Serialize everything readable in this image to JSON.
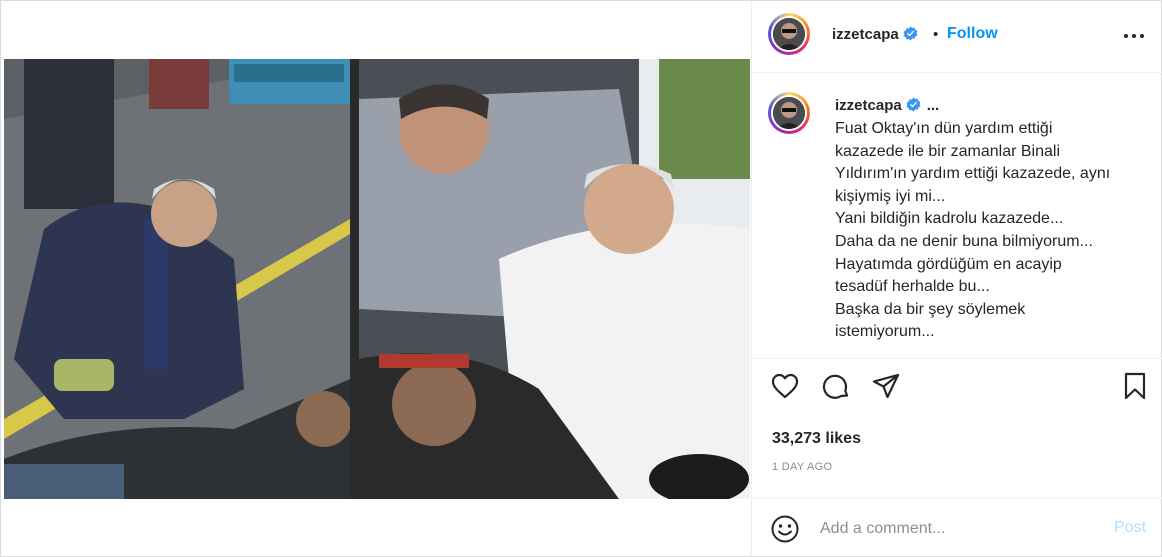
{
  "post": {
    "author": "izzetcapa",
    "follow_label": "Follow",
    "separator": "•",
    "more_icon": "more-horizontal-icon",
    "verified_icon": "verified-badge-icon",
    "caption_ellipsis": "...",
    "caption_lines": [
      "Fuat Oktay'ın dün yardım ettiği",
      "kazazede ile bir zamanlar Binali",
      "Yıldırım'ın yardım ettiği kazazede, aynı",
      "kişiymiş iyi mi...",
      "Yani bildiğin kadrolu kazazede...",
      "Daha da ne denir buna bilmiyorum...",
      "Hayatımda gördüğüm en acayip",
      "tesadüf herhalde bu...",
      "Başka da bir şey söylemek",
      "istemiyorum..."
    ],
    "likes": "33,273 likes",
    "time_ago": "1 DAY AGO"
  },
  "actions": {
    "like_icon": "heart-icon",
    "comment_icon": "comment-bubble-icon",
    "share_icon": "paper-plane-icon",
    "save_icon": "bookmark-icon"
  },
  "comment": {
    "emoji_icon": "emoji-smile-icon",
    "placeholder": "Add a comment...",
    "post_label": "Post"
  },
  "colors": {
    "link_blue": "#0095f6",
    "post_disabled": "#b2dffc",
    "verified_blue": "#3897f0",
    "muted": "#8e8e8e",
    "border": "#efefef"
  }
}
